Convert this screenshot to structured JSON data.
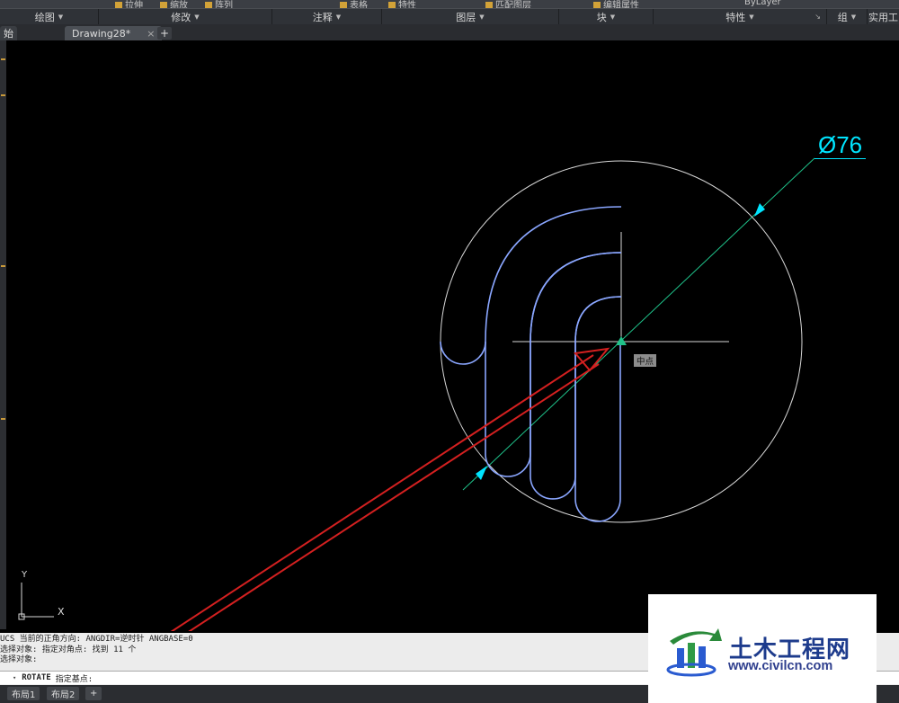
{
  "ribbon": {
    "top_fragments": [
      {
        "label": "拉伸"
      },
      {
        "label": "缩放"
      },
      {
        "label": "阵列"
      },
      {
        "label": "表格"
      },
      {
        "label": "特性"
      },
      {
        "label": "匹配图层"
      },
      {
        "label": "编辑属性"
      },
      {
        "label": "ByLayer"
      }
    ],
    "panels": [
      {
        "label": "绘图"
      },
      {
        "label": "修改"
      },
      {
        "label": "注释"
      },
      {
        "label": "图层"
      },
      {
        "label": "块"
      },
      {
        "label": "特性"
      },
      {
        "label": "组"
      },
      {
        "label": "实用工"
      }
    ],
    "caret": "▼",
    "corner_mark": "↘"
  },
  "tabs": {
    "left_partial": "始",
    "active": "Drawing28*",
    "close": "×",
    "add": "+"
  },
  "canvas": {
    "background": "#000000",
    "dimension_text": "Ø76",
    "dimension_color": "#00e5ff",
    "snap_tooltip": "中点",
    "profile_color": "#8aa6ff",
    "arrow_color": "#d42020"
  },
  "ucs": {
    "x_label": "X",
    "y_label": "Y"
  },
  "command": {
    "history": [
      "UCS 当前的正角方向:  ANGDIR=逆时针  ANGBASE=0",
      "选择对象: 指定对角点: 找到 11 个",
      "选择对象:"
    ],
    "caret": "▾",
    "current_cmd": "ROTATE",
    "prompt": "指定基点:"
  },
  "layouts": {
    "tabs": [
      "布局1",
      "布局2"
    ],
    "add": "+"
  },
  "watermark": {
    "title": "土木工程网",
    "url": "www.civilcn.com"
  }
}
